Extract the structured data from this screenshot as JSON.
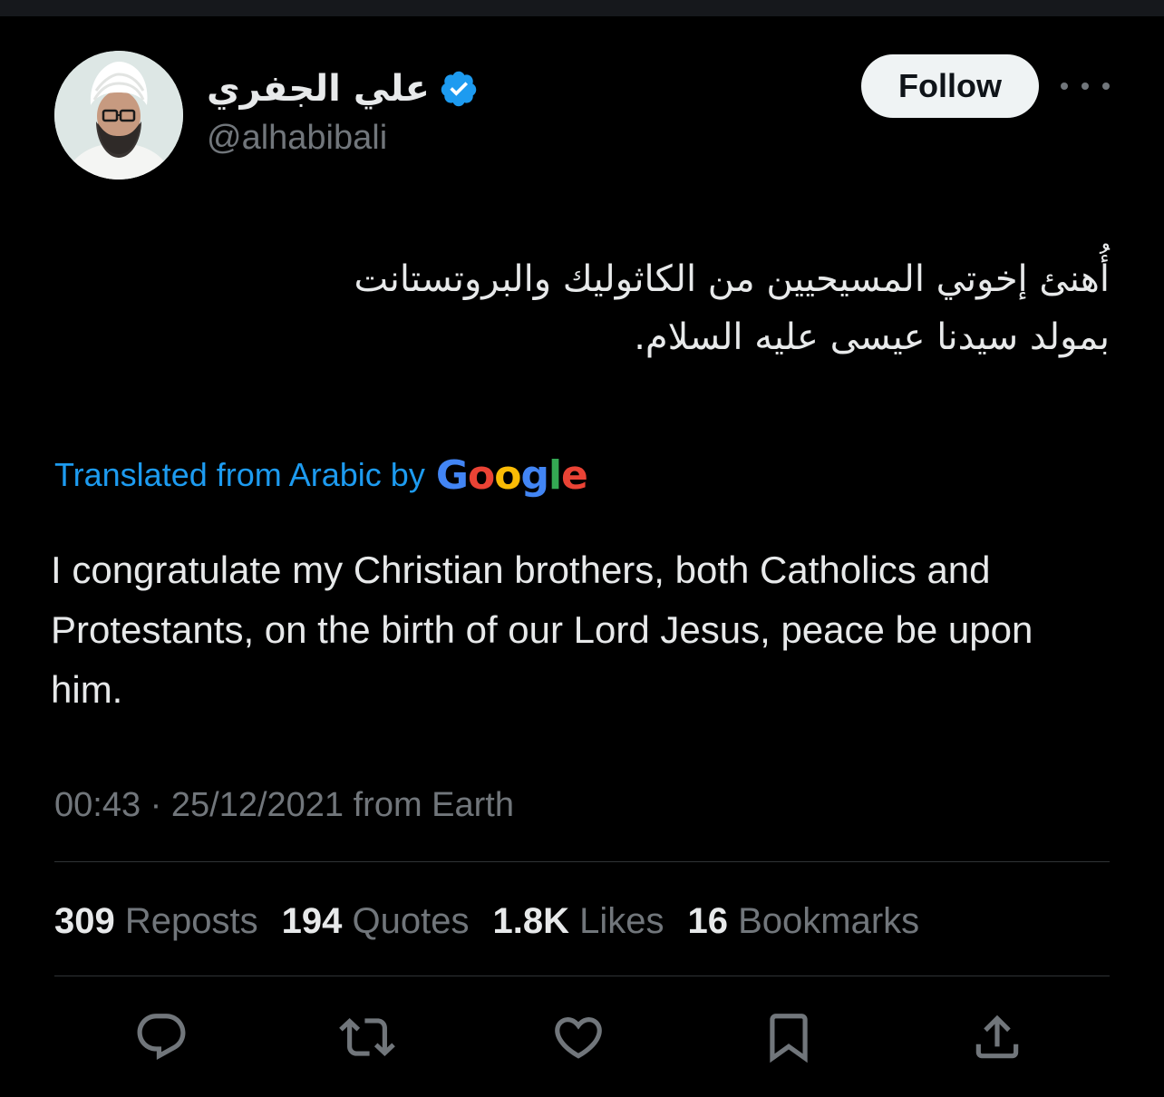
{
  "author": {
    "display_name": "علي الجفري",
    "handle": "@alhabibali",
    "verified": true,
    "avatar_icon": "profile-photo"
  },
  "header": {
    "follow_label": "Follow",
    "more_icon": "more-horizontal-icon"
  },
  "tweet": {
    "arabic_line_1": "أُهنئ إخوتي المسيحيين من الكاثوليك والبروتستانت",
    "arabic_line_2": "بمولد سيدنا عيسى عليه السلام.",
    "translated_label": "Translated from Arabic by",
    "google_brand": "Google",
    "translation": "I congratulate my Christian brothers, both Catholics and Protestants, on the birth of our Lord Jesus, peace be upon him.",
    "meta": "00:43 · 25/12/2021 from Earth"
  },
  "stats": [
    {
      "num": "309",
      "label": "Reposts"
    },
    {
      "num": "194",
      "label": "Quotes"
    },
    {
      "num": "1.8K",
      "label": "Likes"
    },
    {
      "num": "16",
      "label": "Bookmarks"
    }
  ],
  "actions": [
    {
      "name": "reply-icon"
    },
    {
      "name": "repost-icon"
    },
    {
      "name": "like-icon"
    },
    {
      "name": "bookmark-icon"
    },
    {
      "name": "share-icon"
    }
  ],
  "colors": {
    "background": "#000000",
    "text": "#e7e9ea",
    "muted": "#71767b",
    "link": "#1d9bf0",
    "verified": "#1d9bf0",
    "divider": "#2f3336"
  }
}
